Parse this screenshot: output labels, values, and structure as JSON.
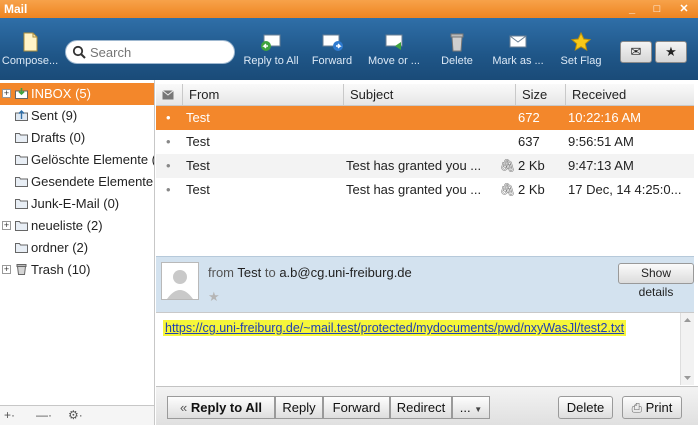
{
  "window": {
    "title": "Mail"
  },
  "window_controls": {
    "minimize": "_",
    "maximize": "□",
    "close": "✕"
  },
  "toolbar": {
    "compose_label": "Compose...",
    "search_placeholder": "Search",
    "reply_all_label": "Reply to All",
    "forward_label": "Forward",
    "move_label": "Move or ...",
    "delete_label": "Delete",
    "mark_label": "Mark as ...",
    "set_flag_label": "Set Flag"
  },
  "sidebar": {
    "folders": [
      {
        "label": "INBOX (5)",
        "icon": "inbox-icon",
        "expandable": true,
        "selected": true
      },
      {
        "label": "Sent (9)",
        "icon": "sent-icon",
        "expandable": false,
        "selected": false
      },
      {
        "label": "Drafts (0)",
        "icon": "folder-icon",
        "expandable": false,
        "selected": false
      },
      {
        "label": "Gelöschte Elemente (0)",
        "icon": "folder-icon",
        "expandable": false,
        "selected": false
      },
      {
        "label": "Gesendete Elemente (0)",
        "icon": "folder-icon",
        "expandable": false,
        "selected": false
      },
      {
        "label": "Junk-E-Mail (0)",
        "icon": "folder-icon",
        "expandable": false,
        "selected": false
      },
      {
        "label": "neueliste (2)",
        "icon": "folder-icon",
        "expandable": true,
        "selected": false
      },
      {
        "label": "ordner (2)",
        "icon": "folder-icon",
        "expandable": false,
        "selected": false
      },
      {
        "label": "Trash (10)",
        "icon": "trash-icon",
        "expandable": true,
        "selected": false
      }
    ],
    "bottom": {
      "add": "+·",
      "remove": "—·",
      "settings": "⚙·"
    }
  },
  "message_list": {
    "columns": {
      "from": "From",
      "subject": "Subject",
      "size": "Size",
      "received": "Received"
    },
    "rows": [
      {
        "from": "Test",
        "subject": "",
        "attachment": false,
        "size": "672",
        "received": "10:22:16 AM",
        "selected": true
      },
      {
        "from": "Test",
        "subject": "",
        "attachment": false,
        "size": "637",
        "received": "9:56:51 AM",
        "selected": false
      },
      {
        "from": "Test",
        "subject": "Test has granted you ...",
        "attachment": true,
        "size": "2 Kb",
        "received": "9:47:13 AM",
        "selected": false
      },
      {
        "from": "Test",
        "subject": "Test has granted you ...",
        "attachment": true,
        "size": "2 Kb",
        "received": "17 Dec, 14 4:25:0...",
        "selected": false
      }
    ]
  },
  "preview": {
    "from_prefix": "from",
    "sender": "Test",
    "to_word": "to",
    "recipient": "a.b@cg.uni-freiburg.de",
    "show_details": "Show details",
    "link": "https://cg.uni-freiburg.de/~mail.test/protected/mydocuments/pwd/nxyWasJl/test2.txt"
  },
  "actions": {
    "reply_all": "Reply to All",
    "reply": "Reply",
    "forward": "Forward",
    "redirect": "Redirect",
    "more": "...",
    "delete": "Delete",
    "print": "Print"
  },
  "colors": {
    "accent": "#f3872b",
    "toolbar": "#1f5688",
    "highlight": "#f6f63a"
  }
}
